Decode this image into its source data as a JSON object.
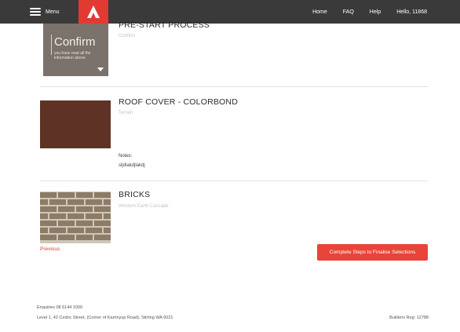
{
  "header": {
    "menu_label": "Menu",
    "logo_icon": "brand-logo-a-icon",
    "nav": [
      "Home",
      "FAQ",
      "Help",
      "Hello, 11868"
    ]
  },
  "items": [
    {
      "title": "PRE-START PROCESS",
      "subtitle": "Confirm",
      "card": {
        "big_text": "Confirm",
        "small_text": "you have read all the information above"
      }
    },
    {
      "title": "ROOF COVER - COLORBOND",
      "subtitle": "Terrain",
      "swatch_color": "#5e3326",
      "notes_label": "Notes:",
      "notes_value": "sljdlakdjlakdj"
    },
    {
      "title": "BRICKS",
      "subtitle": "Western Earth Cascade",
      "brick_color": "#8c7b66"
    }
  ],
  "actions": {
    "previous": "Previous",
    "finalise": "Complete Steps to Finalise Selections"
  },
  "footer": {
    "enquiries": "Enquiries 08 6144 1000",
    "address": "Level 1, 42 Cedric Street, (Corner of Karrinyup Road), Stirling WA 6021",
    "builders_reg": "Builders Reg: 12788"
  },
  "colors": {
    "topbar": "#3a3a3a",
    "accent": "#e03a33"
  }
}
